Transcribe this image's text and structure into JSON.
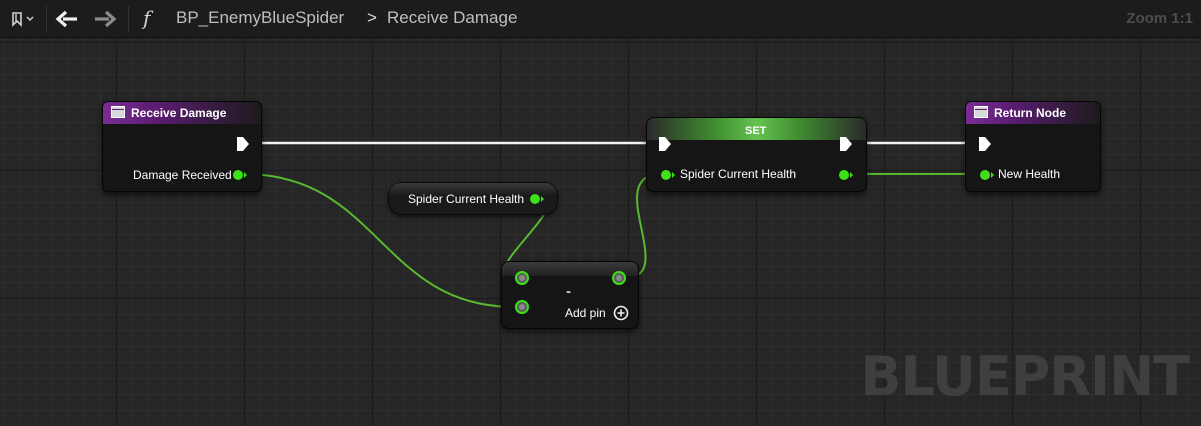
{
  "toolbar": {
    "function_symbol": "f",
    "blueprint_name": "BP_EnemyBlueSpider",
    "separator": ">",
    "graph_name": "Receive Damage",
    "zoom": "Zoom 1:1"
  },
  "canvas": {
    "watermark": "BLUEPRINT"
  },
  "nodes": {
    "entry": {
      "title": "Receive Damage",
      "output_pin": "Damage Received"
    },
    "getter": {
      "label": "Spider Current Health"
    },
    "subtract": {
      "operator": "-",
      "add_pin": "Add pin"
    },
    "set": {
      "title": "SET",
      "input_pin": "Spider Current Health"
    },
    "return": {
      "title": "Return Node",
      "input_pin": "New Health"
    }
  },
  "colors": {
    "exec_wire": "#ffffff",
    "float_wire": "#5bc236",
    "float_pin": "#3ee018",
    "function_header": "#7a2d94",
    "set_header": "#5fbf4c"
  }
}
